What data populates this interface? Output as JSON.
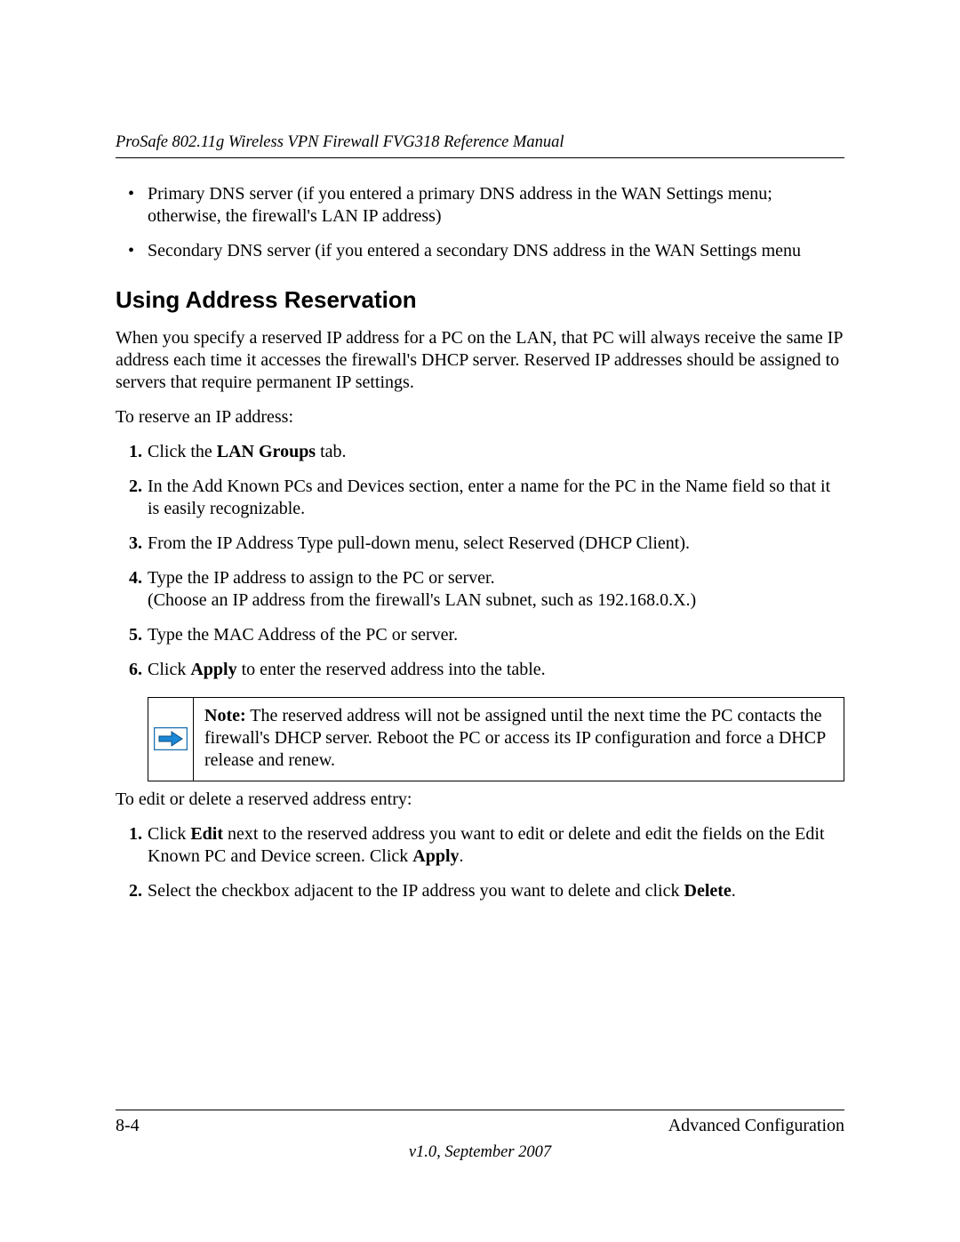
{
  "header": {
    "doc_title": "ProSafe 802.11g Wireless VPN Firewall FVG318 Reference Manual"
  },
  "bullets": [
    "Primary DNS server (if you entered a primary DNS address in the WAN Settings menu; otherwise, the firewall's LAN IP address)",
    "Secondary DNS server (if you entered a secondary DNS address in the WAN Settings menu"
  ],
  "section_heading": "Using Address Reservation",
  "intro_para": "When you specify a reserved IP address for a PC on the LAN, that PC will always receive the same IP address each time it accesses the firewall's DHCP server. Reserved IP addresses should be assigned to servers that require permanent IP settings.",
  "reserve_lead": "To reserve an IP address:",
  "steps": [
    {
      "num": "1.",
      "pre": "Click the ",
      "bold": "LAN Groups",
      "post": " tab."
    },
    {
      "num": "2.",
      "text": "In the Add Known PCs and Devices section, enter a name for the PC in the Name field so that it is easily recognizable."
    },
    {
      "num": "3.",
      "text": "From the IP Address Type pull-down menu, select Reserved (DHCP Client)."
    },
    {
      "num": "4.",
      "line1": "Type the IP address to assign to the PC or server.",
      "line2": "(Choose an IP address from the firewall's LAN subnet, such as 192.168.0.X.)"
    },
    {
      "num": "5.",
      "text": "Type the MAC Address of the PC or server."
    },
    {
      "num": "6.",
      "pre": "Click ",
      "bold": "Apply",
      "post": " to enter the reserved address into the table."
    }
  ],
  "note": {
    "label": "Note:",
    "text": " The reserved address will not be assigned until the next time the PC contacts the firewall's DHCP server. Reboot the PC or access its IP configuration and force a DHCP release and renew."
  },
  "edit_lead": "To edit or delete a reserved address entry:",
  "edit_steps": {
    "s1": {
      "num": "1.",
      "p1": "Click ",
      "b1": "Edit",
      "p2": " next to the reserved address you want to edit or delete and edit the fields on the Edit Known PC and Device screen. Click ",
      "b2": "Apply",
      "p3": "."
    },
    "s2": {
      "num": "2.",
      "p1": "Select the checkbox adjacent to the IP address you want to delete and click ",
      "b1": "Delete",
      "p2": "."
    }
  },
  "footer": {
    "page_num": "8-4",
    "chapter": "Advanced Configuration",
    "version": "v1.0, September 2007"
  }
}
